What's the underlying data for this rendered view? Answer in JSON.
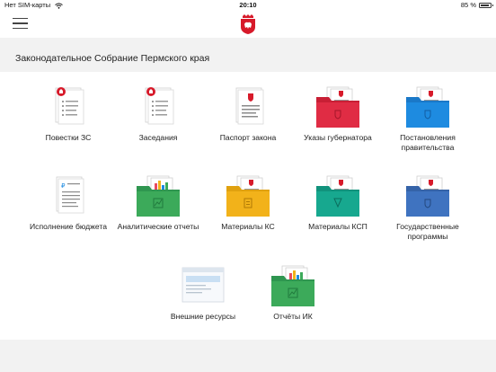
{
  "status_bar": {
    "carrier": "Нет SIM-карты",
    "time": "20:10",
    "battery": "85 %",
    "battery_level": 0.85
  },
  "header": {
    "menu_icon": "hamburger-icon",
    "logo_icon": "perm-krai-emblem"
  },
  "section": {
    "title": "Законодательное Собрание Пермского края"
  },
  "tiles": [
    {
      "label": "Повестки ЗС",
      "icon": "document-with-seal-icon"
    },
    {
      "label": "Заседания",
      "icon": "document-with-seal-icon"
    },
    {
      "label": "Паспорт закона",
      "icon": "document-with-emblem-icon"
    },
    {
      "label": "Указы губернатора",
      "icon": "red-folder-icon"
    },
    {
      "label": "Постановления правительства",
      "icon": "blue-folder-icon"
    },
    {
      "label": "Исполнение бюджета",
      "icon": "ruble-document-icon"
    },
    {
      "label": "Аналитические отчеты",
      "icon": "green-chart-folder-icon"
    },
    {
      "label": "Материалы КС",
      "icon": "yellow-folder-icon"
    },
    {
      "label": "Материалы КСП",
      "icon": "teal-folder-icon"
    },
    {
      "label": "Государственные программы",
      "icon": "blue-folder-icon"
    },
    {
      "label": "Внешние ресурсы",
      "icon": "browser-window-icon"
    },
    {
      "label": "Отчёты ИК",
      "icon": "green-chart-folder-icon"
    }
  ],
  "colors": {
    "red_folder": "#e02c44",
    "blue_folder": "#1e8be0",
    "green_folder": "#3caa5a",
    "yellow_folder": "#f2b21a",
    "teal_folder": "#17a88f",
    "steelblue_folder": "#3f73c0",
    "seal_red": "#d71a2a"
  }
}
